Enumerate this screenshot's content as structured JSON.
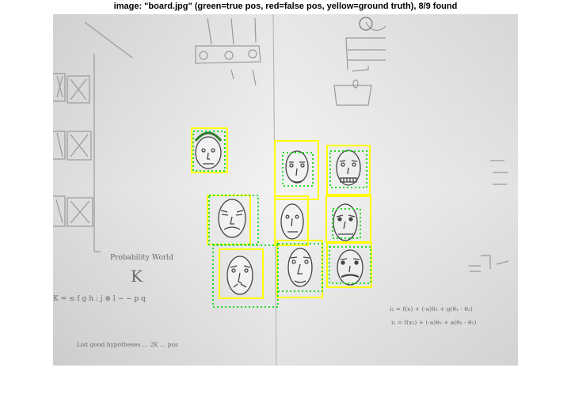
{
  "figure": {
    "title": "image: \"board.jpg\" (green=true pos, red=false pos, yellow=ground truth), 8/9 found"
  },
  "legend_colors": {
    "true_positive": "#22dd22",
    "false_positive": "#ff0000",
    "ground_truth": "#ffff00"
  },
  "board_text": {
    "probability_world": "Probability World",
    "big_k": "K",
    "formula_line": "K = ≤ f g h : j ⊕ l ~ ~ p q",
    "bottom_note": "List good hypotheses ... 2K ... pos",
    "eq_1": "i₁ = f(x) + (-a)θ₁ + g(θ₁ - θ₂)",
    "eq_2": "i₂ = f(x₂) + (-a)θ₂ + a(θ₂ - θ₁)"
  }
}
